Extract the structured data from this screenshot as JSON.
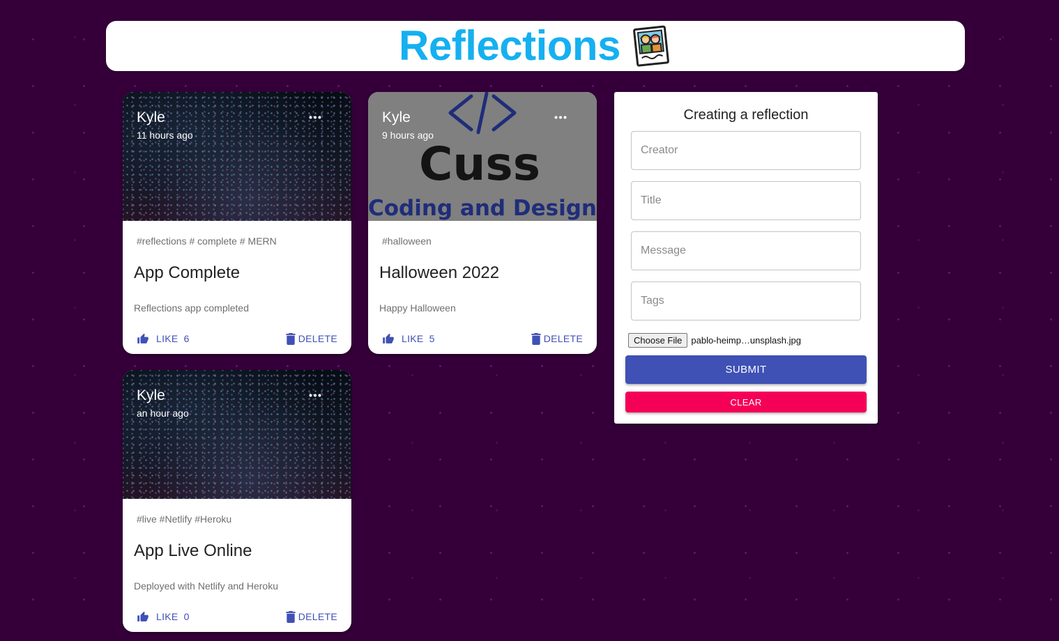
{
  "header": {
    "title": "Reflections",
    "logo_icon": "photo-people-icon"
  },
  "posts": [
    {
      "creator": "Kyle",
      "time": "11 hours ago",
      "tags": "#reflections # complete # MERN",
      "title": "App Complete",
      "message": "Reflections app completed",
      "like_label": "LIKE",
      "like_count": "6",
      "delete_label": "DELETE",
      "image": "party-confetti"
    },
    {
      "creator": "Kyle",
      "time": "9 hours ago",
      "tags": "#halloween",
      "title": "Halloween 2022",
      "message": "Happy Halloween",
      "like_label": "LIKE",
      "like_count": "5",
      "delete_label": "DELETE",
      "image": "cuss-logo",
      "image_text": {
        "line1": "Cuss",
        "line2": "Coding and Design"
      }
    },
    {
      "creator": "Kyle",
      "time": "an hour ago",
      "tags": "#live #Netlify #Heroku",
      "title": "App Live Online",
      "message": "Deployed with Netlify and Heroku",
      "like_label": "LIKE",
      "like_count": "0",
      "delete_label": "DELETE",
      "image": "party-confetti"
    }
  ],
  "form": {
    "heading": "Creating a reflection",
    "creator_placeholder": "Creator",
    "title_placeholder": "Title",
    "message_placeholder": "Message",
    "tags_placeholder": "Tags",
    "file_button": "Choose File",
    "file_name": "pablo-heimp…unsplash.jpg",
    "submit_label": "SUBMIT",
    "clear_label": "CLEAR"
  },
  "colors": {
    "background": "#35003a",
    "title": "#15b0f0",
    "primary": "#3f51b5",
    "secondary": "#f50057"
  }
}
